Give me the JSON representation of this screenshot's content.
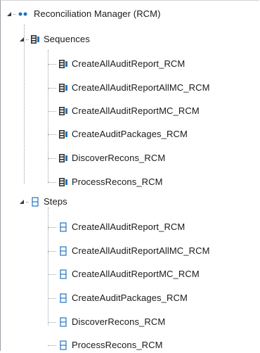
{
  "tree": {
    "root": {
      "label": "Reconciliation Manager (RCM)",
      "icon": "service-dots-icon",
      "expanded": true
    },
    "groups": [
      {
        "label": "Sequences",
        "icon": "sequence-icon",
        "expanded": true,
        "children": [
          "CreateAllAuditReport_RCM",
          "CreateAllAuditReportAllMC_RCM",
          "CreateAllAuditReportMC_RCM",
          "CreateAuditPackages_RCM",
          "DiscoverRecons_RCM",
          "ProcessRecons_RCM"
        ]
      },
      {
        "label": "Steps",
        "icon": "step-icon",
        "expanded": true,
        "children": [
          "CreateAllAuditReport_RCM",
          "CreateAllAuditReportAllMC_RCM",
          "CreateAllAuditReportMC_RCM",
          "CreateAuditPackages_RCM",
          "DiscoverRecons_RCM",
          "ProcessRecons_RCM"
        ]
      }
    ]
  },
  "colors": {
    "accent": "#1e73be",
    "connector": "#9aa0a6",
    "expander": "#3a3a3a"
  }
}
